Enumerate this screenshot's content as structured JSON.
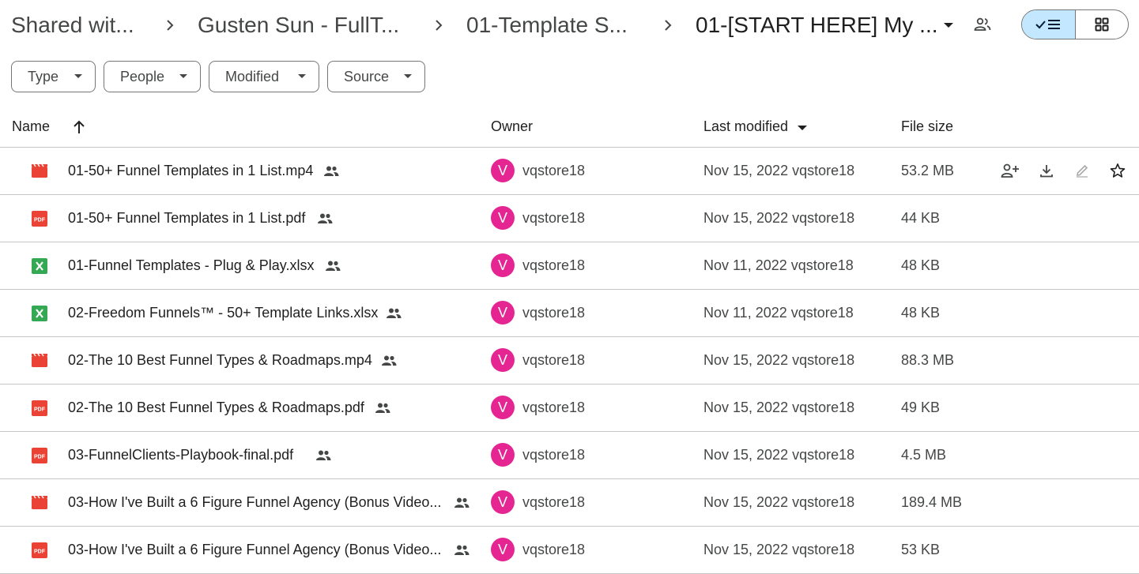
{
  "breadcrumb": [
    {
      "label": "Shared wit..."
    },
    {
      "label": "Gusten Sun - FullT..."
    },
    {
      "label": "01-Template S..."
    },
    {
      "label": "01-[START HERE] My ..."
    }
  ],
  "filters": [
    "Type",
    "People",
    "Modified",
    "Source"
  ],
  "columns": {
    "name": "Name",
    "owner": "Owner",
    "modified": "Last modified",
    "size": "File size"
  },
  "files": [
    {
      "name": "01-50+ Funnel Templates in 1 List.mp4",
      "type": "video",
      "owner": "vqstore18",
      "avatar": "V",
      "modified": "Nov 15, 2022 vqstore18",
      "size": "53.2 MB",
      "hovered": true
    },
    {
      "name": "01-50+ Funnel Templates in 1 List.pdf",
      "type": "pdf",
      "owner": "vqstore18",
      "avatar": "V",
      "modified": "Nov 15, 2022 vqstore18",
      "size": "44 KB"
    },
    {
      "name": "01-Funnel Templates - Plug & Play.xlsx",
      "type": "sheet",
      "owner": "vqstore18",
      "avatar": "V",
      "modified": "Nov 11, 2022 vqstore18",
      "size": "48 KB"
    },
    {
      "name": "02-Freedom Funnels™ - 50+ Template Links.xlsx",
      "type": "sheet",
      "owner": "vqstore18",
      "avatar": "V",
      "modified": "Nov 11, 2022 vqstore18",
      "size": "48 KB"
    },
    {
      "name": "02-The 10 Best Funnel Types & Roadmaps.mp4",
      "type": "video",
      "owner": "vqstore18",
      "avatar": "V",
      "modified": "Nov 15, 2022 vqstore18",
      "size": "88.3 MB"
    },
    {
      "name": "02-The 10 Best Funnel Types & Roadmaps.pdf",
      "type": "pdf",
      "owner": "vqstore18",
      "avatar": "V",
      "modified": "Nov 15, 2022 vqstore18",
      "size": "49 KB"
    },
    {
      "name": "03-FunnelClients-Playbook-final.pdf",
      "type": "pdf",
      "owner": "vqstore18",
      "avatar": "V",
      "modified": "Nov 15, 2022 vqstore18",
      "size": "4.5 MB"
    },
    {
      "name": "03-How I've Built a 6 Figure Funnel Agency (Bonus Video...",
      "type": "video",
      "owner": "vqstore18",
      "avatar": "V",
      "modified": "Nov 15, 2022 vqstore18",
      "size": "189.4 MB"
    },
    {
      "name": "03-How I've Built a 6 Figure Funnel Agency (Bonus Video...",
      "type": "pdf",
      "owner": "vqstore18",
      "avatar": "V",
      "modified": "Nov 15, 2022 vqstore18",
      "size": "53 KB"
    }
  ],
  "colors": {
    "avatar": "#e52592",
    "video": "#ea4335",
    "pdf": "#ea4335",
    "sheet": "#34a853",
    "toggle_active": "#c2e7ff"
  },
  "icons": {
    "video": "film-icon",
    "pdf": "pdf-icon",
    "sheet": "spreadsheet-icon",
    "shared": "shared-people-icon"
  }
}
